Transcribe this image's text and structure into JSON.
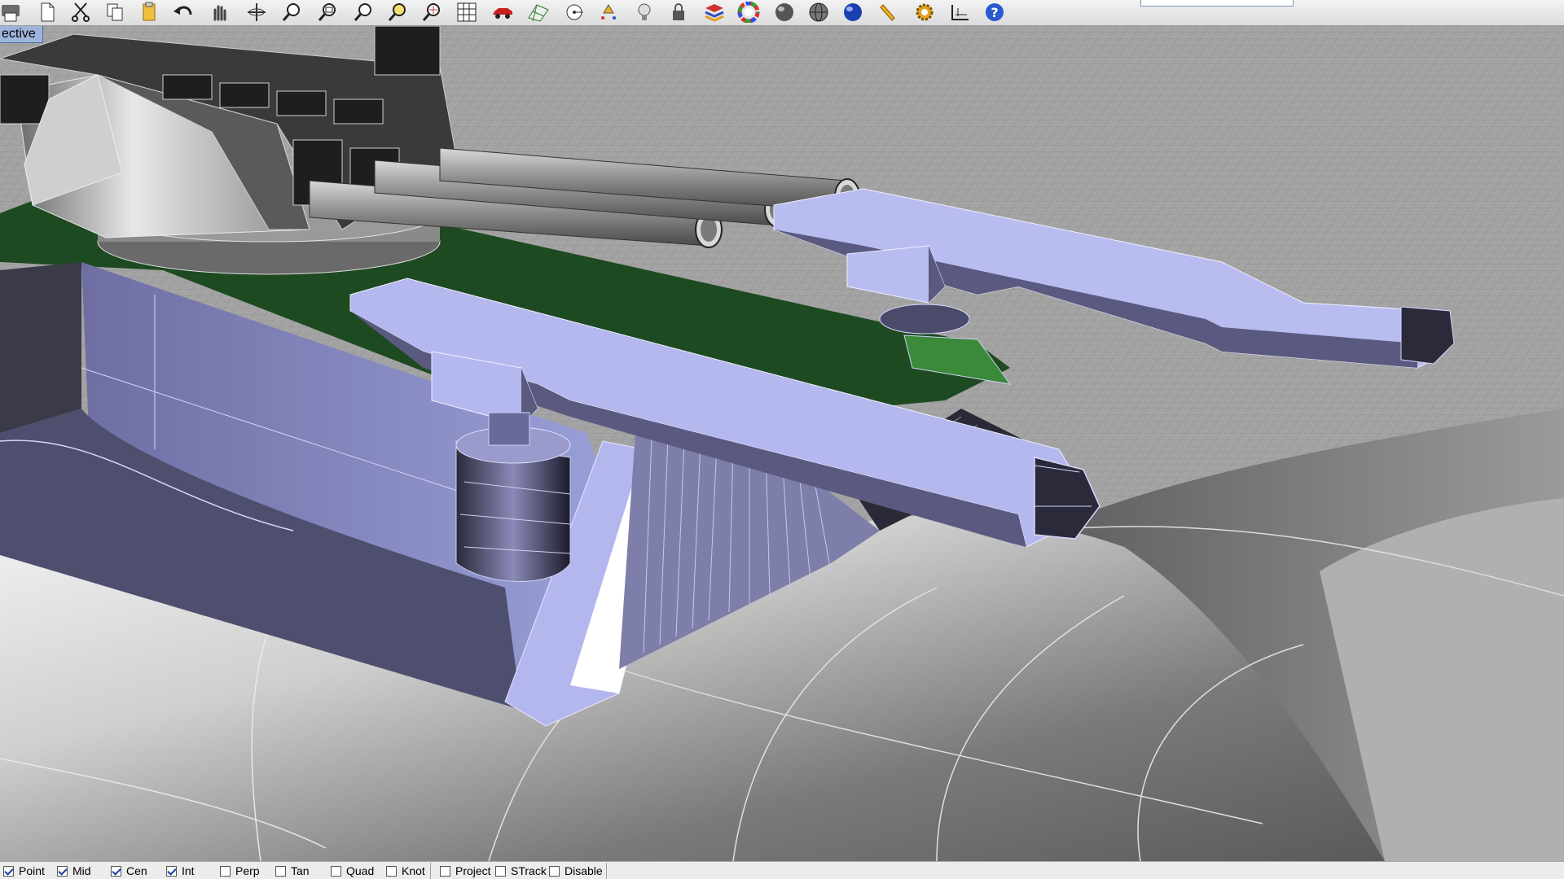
{
  "viewport": {
    "label": "ective"
  },
  "toolbar": {
    "icons": [
      "print-icon",
      "new-icon",
      "cut-icon",
      "copy-icon",
      "paste-icon",
      "undo-icon",
      "pan-icon",
      "rotate-view-icon",
      "zoom-dynamic-icon",
      "zoom-window-icon",
      "zoom-extents-icon",
      "zoom-selected-icon",
      "zoom-target-icon",
      "grid-icon",
      "car-icon",
      "mesh-grid-icon",
      "circle-point-icon",
      "point-cloud-icon",
      "lightbulb-icon",
      "lock-icon",
      "layers-icon",
      "color-wheel-icon",
      "shaded-sphere-icon",
      "wire-sphere-icon",
      "render-sphere-icon",
      "pen-icon",
      "gear-icon",
      "dimension-icon",
      "help-icon"
    ]
  },
  "statusbar": {
    "items": [
      {
        "label": "Point",
        "checked": true
      },
      {
        "label": "Mid",
        "checked": true
      },
      {
        "label": "Cen",
        "checked": true
      },
      {
        "label": "Int",
        "checked": true
      },
      {
        "label": "Perp",
        "checked": false
      },
      {
        "label": "Tan",
        "checked": false
      },
      {
        "label": "Quad",
        "checked": false
      },
      {
        "label": "Knot",
        "checked": false
      },
      {
        "label": "Project",
        "checked": false
      },
      {
        "label": "STrack",
        "checked": false
      },
      {
        "label": "Disable",
        "checked": false
      }
    ]
  },
  "colors": {
    "accent_lavender": "#aaaee6",
    "deck_green": "#1e4a22",
    "hull_gray": "#6f6f6f",
    "viewport_label_bg": "#9fb4dc"
  }
}
